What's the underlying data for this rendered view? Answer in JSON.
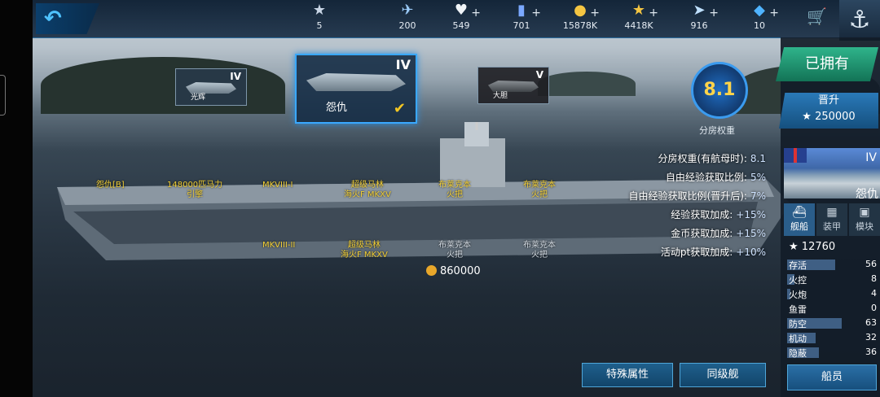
{
  "topbar": {
    "back_icon": "back-arrow-icon",
    "resources": [
      {
        "name": "rank-badge-icon",
        "glyph": "★",
        "value": "5",
        "plus": ""
      },
      {
        "name": "exp-icon",
        "glyph": "✈",
        "value": "200",
        "plus": ""
      },
      {
        "name": "heart-icon",
        "glyph": "♥",
        "value": "549",
        "plus": "+"
      },
      {
        "name": "card-icon",
        "glyph": "▮",
        "value": "701",
        "plus": "+"
      },
      {
        "name": "gold-coin-icon",
        "glyph": "●",
        "value": "15878K",
        "plus": "+"
      },
      {
        "name": "star-icon",
        "glyph": "★",
        "value": "4418K",
        "plus": "+"
      },
      {
        "name": "wing-icon",
        "glyph": "➤",
        "value": "916",
        "plus": "+"
      },
      {
        "name": "gem-icon",
        "glyph": "◆",
        "value": "10",
        "plus": "+"
      }
    ]
  },
  "ships": {
    "prev": {
      "tier": "IV",
      "name": "光辉"
    },
    "current": {
      "tier": "IV",
      "name": "怨仇"
    },
    "next": {
      "tier": "V",
      "name": "大胆"
    }
  },
  "rating": {
    "value": "8.1",
    "label": "分房权重"
  },
  "stats": [
    {
      "label": "分房权重(有航母时):",
      "value": "8.1"
    },
    {
      "label": "自由经验获取比例:",
      "value": "5%"
    },
    {
      "label": "自由经验获取比例(晋升后):",
      "value": "7%"
    },
    {
      "label": "经验获取加成:",
      "value": "+15%"
    },
    {
      "label": "金币获取加成:",
      "value": "+15%"
    },
    {
      "label": "活动pt获取加成:",
      "value": "+10%"
    }
  ],
  "planes_top": [
    {
      "l1": "",
      "l2": "怨仇[B]"
    },
    {
      "l1": "148000匹马力",
      "l2": "引擎"
    },
    {
      "l1": "",
      "l2": "MKVIII-I"
    },
    {
      "l1": "超级马林",
      "l2": "海火F MKXV"
    },
    {
      "l1": "布莱克本",
      "l2": "火把"
    },
    {
      "l1": "布莱克本",
      "l2": "火把"
    }
  ],
  "planes_bottom": [
    {
      "l1": "",
      "l2": "MKVIII-II"
    },
    {
      "l1": "超级马林",
      "l2": "海火F MKXV"
    },
    {
      "l1": "布莱克本",
      "l2": "火把"
    },
    {
      "l1": "布莱克本",
      "l2": "火把"
    }
  ],
  "upgrade_cost": "860000",
  "buttons": {
    "special": "特殊属性",
    "same_class": "同级舰"
  },
  "panel": {
    "owned": "已拥有",
    "promote": "晋升",
    "promote_cost": "★ 250000",
    "ship_tier": "IV",
    "ship_name": "怨仇",
    "tabs": [
      {
        "label": "舰船",
        "icon": "ship-icon"
      },
      {
        "label": "装甲",
        "icon": "armor-icon"
      },
      {
        "label": "模块",
        "icon": "module-icon"
      }
    ],
    "power": "12760",
    "attributes": [
      {
        "label": "存活",
        "value": "56",
        "fill": 0.55
      },
      {
        "label": "火控",
        "value": "8",
        "fill": 0.08
      },
      {
        "label": "火炮",
        "value": "4",
        "fill": 0.04
      },
      {
        "label": "鱼雷",
        "value": "0",
        "fill": 0
      },
      {
        "label": "防空",
        "value": "63",
        "fill": 0.62
      },
      {
        "label": "机动",
        "value": "32",
        "fill": 0.32
      },
      {
        "label": "隐蔽",
        "value": "36",
        "fill": 0.36
      }
    ],
    "crew": "船员"
  }
}
